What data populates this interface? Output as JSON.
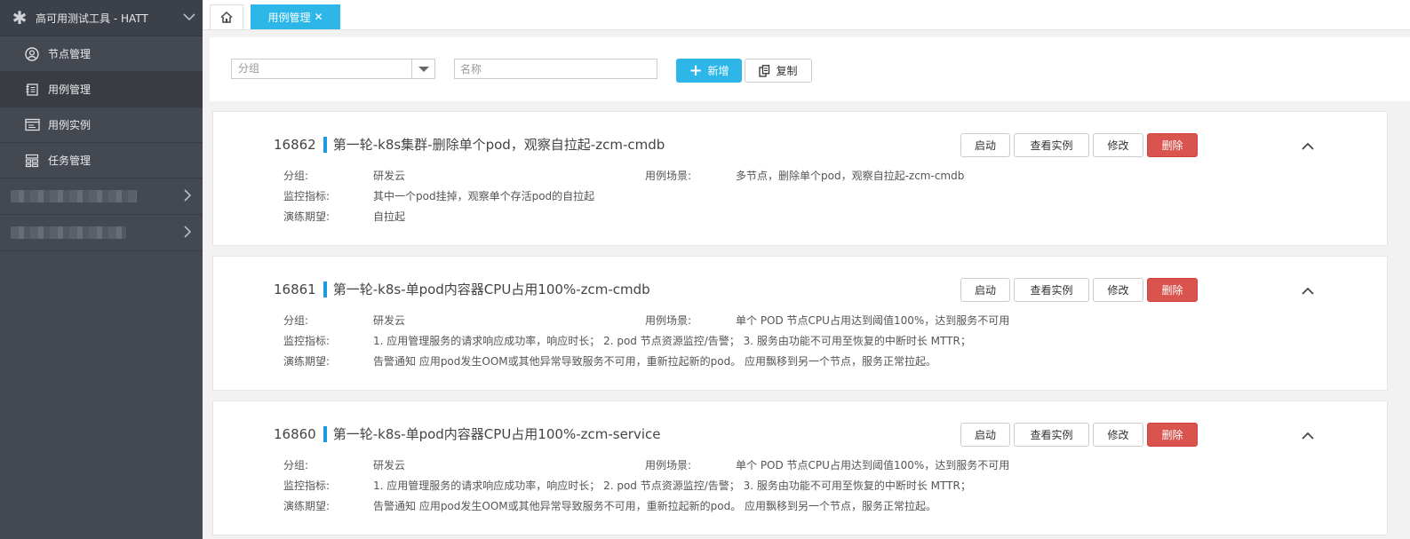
{
  "sidebar": {
    "app_title": "高可用测试工具 - HATT",
    "items": [
      {
        "label": "节点管理",
        "icon": "user-circle-icon"
      },
      {
        "label": "用例管理",
        "icon": "notebook-icon"
      },
      {
        "label": "用例实例",
        "icon": "window-icon"
      },
      {
        "label": "任务管理",
        "icon": "task-grid-icon"
      }
    ]
  },
  "tabs": {
    "home_icon": "home-icon",
    "active_label": "用例管理",
    "close_glyph": "✕"
  },
  "toolbar": {
    "group_placeholder": "分组",
    "name_placeholder": "名称",
    "add_label": "新增",
    "copy_label": "复制"
  },
  "labels": {
    "group": "分组:",
    "scene": "用例场景:",
    "metric": "监控指标:",
    "expect": "演练期望:"
  },
  "actions": {
    "start": "启动",
    "view": "查看实例",
    "edit": "修改",
    "delete": "删除"
  },
  "cases": [
    {
      "id": "16862",
      "title": "第一轮-k8s集群-删除单个pod，观察自拉起-zcm-cmdb",
      "group": "研发云",
      "scene": "多节点，删除单个pod，观察自拉起-zcm-cmdb",
      "metric": "其中一个pod挂掉，观察单个存活pod的自拉起",
      "expect": "自拉起"
    },
    {
      "id": "16861",
      "title": "第一轮-k8s-单pod内容器CPU占用100%-zcm-cmdb",
      "group": "研发云",
      "scene": "单个 POD 节点CPU占用达到阈值100%，达到服务不可用",
      "metric": "1. 应用管理服务的请求响应成功率，响应时长； 2. pod 节点资源监控/告警； 3. 服务由功能不可用至恢复的中断时长 MTTR；",
      "expect": "告警通知 应用pod发生OOM或其他异常导致服务不可用，重新拉起新的pod。 应用飘移到另一个节点，服务正常拉起。"
    },
    {
      "id": "16860",
      "title": "第一轮-k8s-单pod内容器CPU占用100%-zcm-service",
      "group": "研发云",
      "scene": "单个 POD 节点CPU占用达到阈值100%，达到服务不可用",
      "metric": "1. 应用管理服务的请求响应成功率，响应时长； 2. pod 节点资源监控/告警； 3. 服务由功能不可用至恢复的中断时长 MTTR；",
      "expect": "告警通知 应用pod发生OOM或其他异常导致服务不可用，重新拉起新的pod。 应用飘移到另一个节点，服务正常拉起。"
    }
  ],
  "colors": {
    "sidebar_bg": "#444851",
    "accent": "#2db7e9",
    "danger": "#d9534f",
    "title_bar": "#1e9be0"
  }
}
